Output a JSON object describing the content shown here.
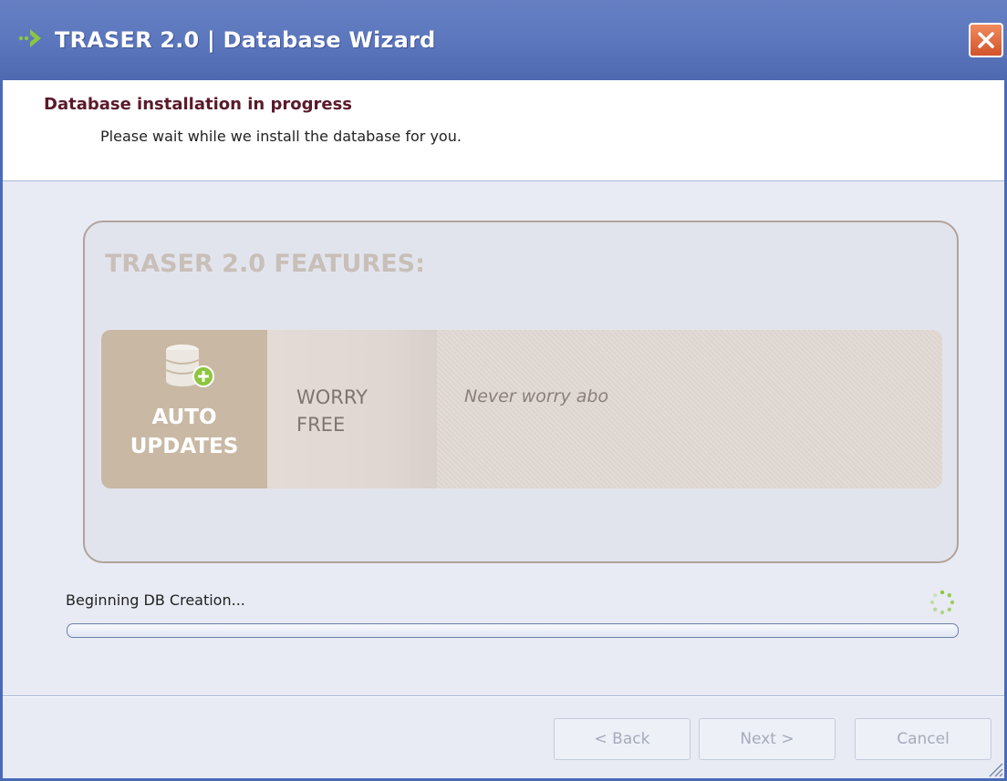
{
  "window": {
    "title": "TRASER 2.0 | Database Wizard"
  },
  "header": {
    "title": "Database installation in progress",
    "subtitle": "Please wait while we install the database for you."
  },
  "features": {
    "heading": "TRASER 2.0 FEATURES:",
    "tile": {
      "line1": "AUTO",
      "line2": "UPDATES",
      "icon": "database-add-icon"
    },
    "name": {
      "line1": "WORRY",
      "line2": "FREE"
    },
    "description": "Never worry abo"
  },
  "status": {
    "text": "Beginning DB Creation...",
    "progress": 0
  },
  "buttons": {
    "back": "< Back",
    "next": "Next >",
    "cancel": "Cancel"
  },
  "colors": {
    "titlebar": "#5c77bd",
    "close": "#e26b3f",
    "tile": "#c9b9a4",
    "header_title": "#5a1a2a",
    "spinner": "#8cc63f"
  }
}
